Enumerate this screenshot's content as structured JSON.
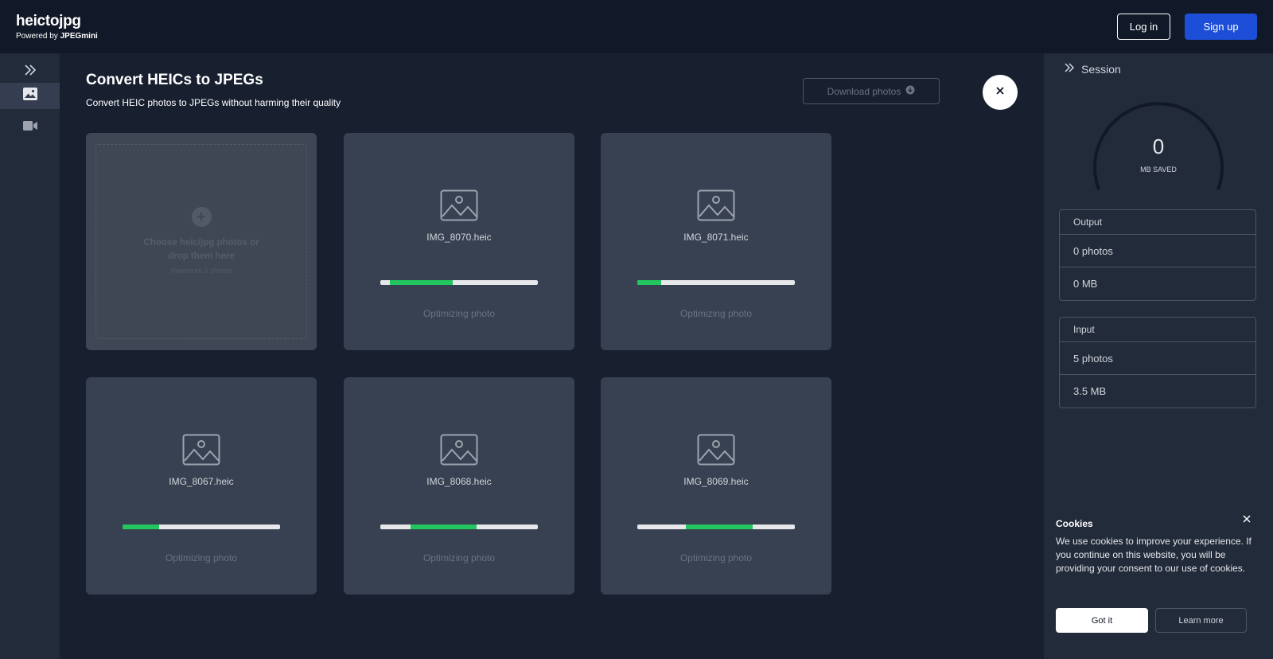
{
  "header": {
    "title": "heictojpg",
    "powered_prefix": "Powered by",
    "powered_brand": "JPEGmini",
    "login_label": "Log in",
    "signup_label": "Sign up"
  },
  "leftbar": {
    "items": [
      {
        "icon": "image-icon",
        "active": true
      },
      {
        "icon": "video-icon",
        "active": false
      }
    ]
  },
  "main": {
    "title": "Convert HEICs to JPEGs",
    "subtitle": "Convert HEIC photos to JPEGs without harming their quality",
    "download_label": "Download photos"
  },
  "dropzone": {
    "text": "Choose heic/jpg photos or drop them here",
    "max": "Maximum 5 photos"
  },
  "photos": [
    {
      "name": "IMG_8070.heic",
      "status": "Optimizing photo",
      "fill_start": 0.06,
      "fill_end": 0.46
    },
    {
      "name": "IMG_8071.heic",
      "status": "Optimizing photo",
      "fill_start": 0.0,
      "fill_end": 0.15
    },
    {
      "name": "IMG_8067.heic",
      "status": "Optimizing photo",
      "fill_start": 0.0,
      "fill_end": 0.23
    },
    {
      "name": "IMG_8068.heic",
      "status": "Optimizing photo",
      "fill_start": 0.19,
      "fill_end": 0.61
    },
    {
      "name": "IMG_8069.heic",
      "status": "Optimizing photo",
      "fill_start": 0.31,
      "fill_end": 0.73
    }
  ],
  "session": {
    "title": "Session",
    "saved_value": "0",
    "saved_label": "MB SAVED",
    "output": {
      "title": "Output",
      "photos": "0 photos",
      "size": "0 MB"
    },
    "input": {
      "title": "Input",
      "photos": "5 photos",
      "size": "3.5 MB"
    }
  },
  "cookies": {
    "title": "Cookies",
    "text": "We use cookies to improve your experience. If you continue on this website, you will be providing your consent to our use of cookies.",
    "gotit_label": "Got it",
    "learn_label": "Learn more"
  },
  "colors": {
    "background": "#182030",
    "header": "#111827",
    "card": "#374151",
    "accent": "#1d4ed8",
    "progress": "#22c55e"
  }
}
